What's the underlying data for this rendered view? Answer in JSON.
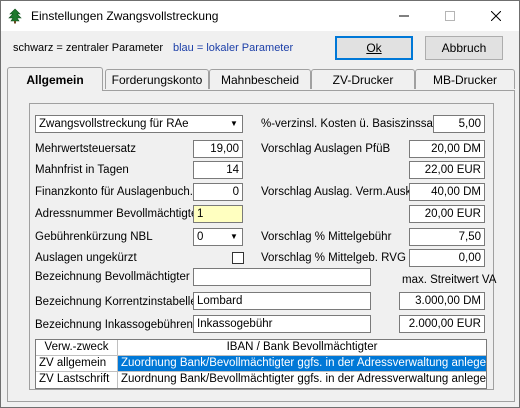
{
  "window": {
    "title": "Einstellungen Zwangsvollstreckung"
  },
  "legend": {
    "black": "schwarz = zentraler Parameter",
    "blue": "blau = lokaler Parameter"
  },
  "buttons": {
    "ok": "Ok",
    "cancel": "Abbruch"
  },
  "tabs": [
    "Allgemein",
    "Forderungskonto",
    "Mahnbescheid",
    "ZV-Drucker",
    "MB-Drucker"
  ],
  "left": {
    "combo_value": "Zwangsvollstreckung für RAe",
    "vat_label": "Mehrwertsteuersatz",
    "vat_value": "19,00",
    "deadline_label": "Mahnfrist in Tagen",
    "deadline_value": "14",
    "account_label": "Finanzkonto für Auslagenbuch.",
    "account_value": "0",
    "address_label": "Adressnummer Bevollmächtigter",
    "address_value": "1",
    "reduction_label": "Gebührenkürzung NBL",
    "reduction_value": "0",
    "unshortened_label": "Auslagen ungekürzt"
  },
  "right": {
    "interest_label": "%-verzinsl. Kosten ü. Basiszinssatz",
    "interest_value": "5,00",
    "pfueb_label": "Vorschlag Auslagen PfüB",
    "pfueb_value": "20,00 DM",
    "eur1_value": "22,00 EUR",
    "verm_label": "Vorschlag Auslag. Verm.Ausk.",
    "verm_value": "40,00 DM",
    "eur2_value": "20,00 EUR",
    "mittel_label": "Vorschlag % Mittelgebühr",
    "mittel_value": "7,50",
    "rvg_label": "Vorschlag % Mittelgeb. RVG",
    "rvg_value": "0,00",
    "streitwert_label": "max. Streitwert VA"
  },
  "bottom": {
    "bev_label": "Bezeichnung Bevollmächtigter",
    "bev_value": "",
    "korr_label": "Bezeichnung Korrentzinstabelle",
    "korr_value": "Lombard",
    "korr_amount": "3.000,00 DM",
    "inkasso_label": "Bezeichnung Inkassogebühren",
    "inkasso_value": "Inkassogebühr",
    "inkasso_amount": "2.000,00 EUR"
  },
  "grid": {
    "headers": [
      "Verw.-zweck",
      "IBAN / Bank Bevollmächtigter"
    ],
    "rows": [
      {
        "purpose": "ZV allgemein",
        "iban": "Zuordnung Bank/Bevollmächtigter ggfs. in der Adressverwaltung anlegen."
      },
      {
        "purpose": "ZV Lastschrift",
        "iban": "Zuordnung Bank/Bevollmächtigter ggfs. in der Adressverwaltung anlegen."
      }
    ]
  },
  "icons": {
    "app": "tree-icon",
    "minimize": "minimize-icon",
    "maximize": "maximize-icon",
    "close": "close-icon",
    "dropdown": "chevron-down-icon"
  },
  "colors": {
    "accent": "#0078d7",
    "local_param": "#1c3fa8",
    "highlight_field": "#ffffc0"
  }
}
